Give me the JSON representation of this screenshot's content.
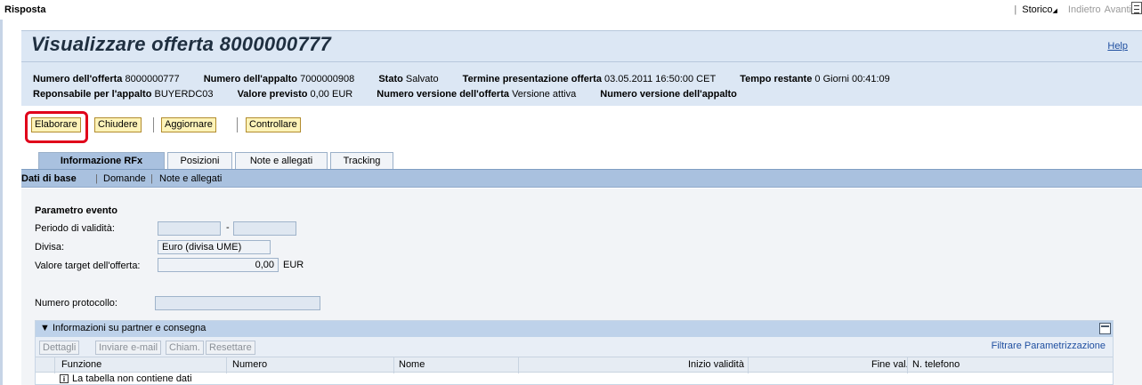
{
  "top": {
    "title": "Risposta",
    "sep": "|",
    "storico": "Storico",
    "indietro": "Indietro",
    "avanti": "Avanti"
  },
  "header": {
    "title": "Visualizzare offerta 8000000777",
    "help": "Help",
    "row1": [
      {
        "label": "Numero dell'offerta",
        "value": "8000000777"
      },
      {
        "label": "Numero dell'appalto",
        "value": "7000000908"
      },
      {
        "label": "Stato",
        "value": "Salvato"
      },
      {
        "label": "Termine presentazione offerta",
        "value": "03.05.2011 16:50:00 CET"
      },
      {
        "label": "Tempo restante",
        "value": "0 Giorni 00:41:09"
      }
    ],
    "row2": [
      {
        "label": "Reponsabile per l'appalto",
        "value": "BUYERDC03"
      },
      {
        "label": "Valore previsto",
        "value": "0,00 EUR"
      },
      {
        "label": "Numero versione dell'offerta",
        "value": "Versione attiva"
      },
      {
        "label": "Numero versione dell'appalto",
        "value": ""
      }
    ]
  },
  "toolbar": {
    "elaborare": "Elaborare",
    "chiudere": "Chiudere",
    "aggiornare": "Aggiornare",
    "controllare": "Controllare"
  },
  "tabs": [
    "Informazione RFx",
    "Posizioni",
    "Note e allegati",
    "Tracking"
  ],
  "subnav": {
    "dati": "Dati di base",
    "sep": "|",
    "domande": "Domande",
    "note": "Note e allegati"
  },
  "form": {
    "section_title": "Parametro evento",
    "periodo_label": "Periodo di validità:",
    "dash": "-",
    "divisa_label": "Divisa:",
    "divisa_value": "Euro (divisa UME)",
    "valore_label": "Valore target dell'offerta:",
    "valore_value": "0,00",
    "valore_unit": "EUR",
    "protocollo_label": "Numero protocollo:"
  },
  "tray": {
    "title": "Informazioni su partner e consegna",
    "buttons": [
      "Dettagli",
      "Inviare e-mail",
      "Chiam.",
      "Resettare"
    ],
    "filtrare": "Filtrare",
    "parametrizzazione": "Parametrizzazione",
    "columns": [
      "Funzione",
      "Numero",
      "Nome",
      "Inizio validità",
      "Fine val.",
      "N. telefono"
    ],
    "empty": "La tabella non contiene dati"
  },
  "colors": {
    "header_bg": "#dce7f4",
    "tab_active": "#a9c1df",
    "button_bg": "#fdf3b8",
    "highlight": "#e0001a"
  },
  "icons": [
    "menu-icon",
    "collapse-triangle-icon",
    "minimize-icon",
    "info-icon"
  ]
}
